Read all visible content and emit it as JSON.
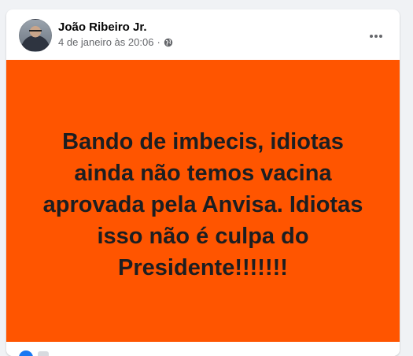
{
  "post": {
    "author_name": "João Ribeiro Jr.",
    "date": "4 de janeiro às 20:06",
    "separator": "·",
    "privacy_icon": "globe-icon",
    "more_icon": "more-horizontal-icon",
    "banner_text": "Bando de imbecis, idiotas ainda não temos vacina aprovada pela Anvisa. Idiotas isso não é culpa do Presidente!!!!!!!",
    "reaction_icon": "like-icon"
  },
  "colors": {
    "banner_background": "#ff5500",
    "banner_text": "#1c1e21",
    "like_blue": "#1877f2",
    "meta_gray": "#65676b"
  }
}
